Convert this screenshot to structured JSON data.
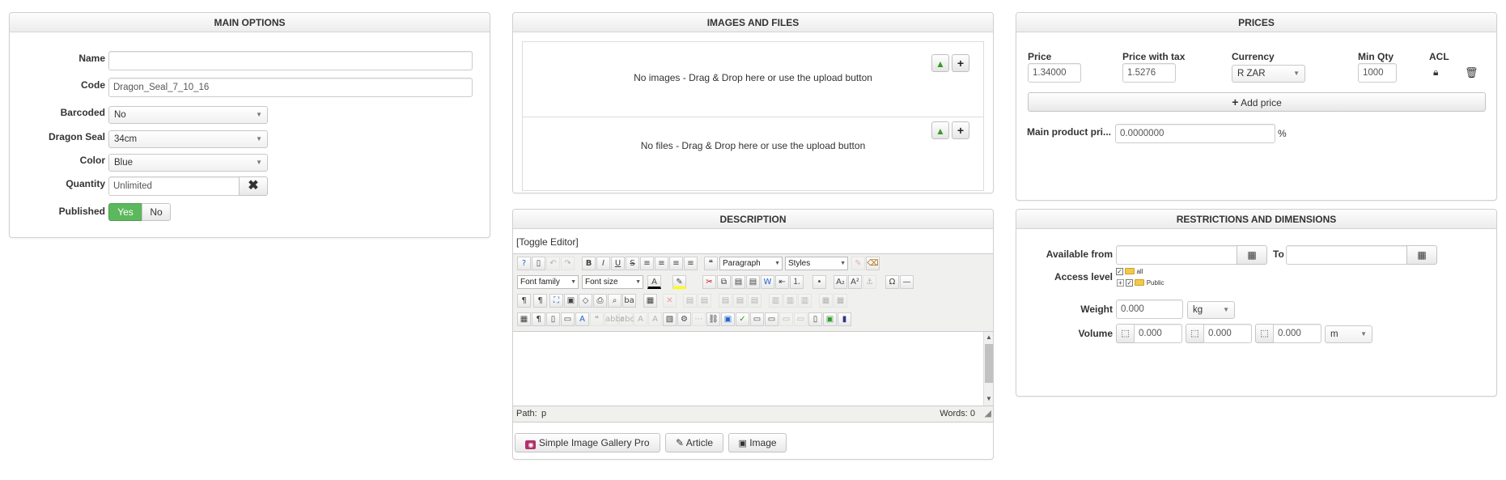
{
  "main_options": {
    "title": "MAIN OPTIONS",
    "name_label": "Name",
    "name_value": "",
    "code_label": "Code",
    "code_value": "Dragon_Seal_7_10_16",
    "barcoded_label": "Barcoded",
    "barcoded_value": "No",
    "dragon_seal_label": "Dragon Seal",
    "dragon_seal_value": "34cm",
    "color_label": "Color",
    "color_value": "Blue",
    "quantity_label": "Quantity",
    "quantity_value": "Unlimited",
    "published_label": "Published",
    "published_yes": "Yes",
    "published_no": "No"
  },
  "images_files": {
    "title": "IMAGES AND FILES",
    "no_images": "No images - Drag & Drop here or use the upload button",
    "no_files": "No files - Drag & Drop here or use the upload button"
  },
  "description": {
    "title": "DESCRIPTION",
    "toggle_editor": "[Toggle Editor]",
    "paragraph": "Paragraph",
    "styles": "Styles",
    "font_family": "Font family",
    "font_size": "Font size",
    "path_label": "Path:",
    "path_value": "p",
    "words_label": "Words: 0",
    "gallery_button": "Simple Image Gallery Pro",
    "article_button": "Article",
    "image_button": "Image"
  },
  "prices": {
    "title": "PRICES",
    "price_label": "Price",
    "price_tax_label": "Price with tax",
    "currency_label": "Currency",
    "min_qty_label": "Min Qty",
    "acl_label": "ACL",
    "price_value": "1.34000",
    "price_tax_value": "1.5276",
    "currency_value": "R ZAR",
    "min_qty_value": "1000",
    "add_price": "Add price",
    "main_product_label": "Main product pri...",
    "main_product_value": "0.0000000",
    "percent": "%"
  },
  "restrictions": {
    "title": "RESTRICTIONS AND DIMENSIONS",
    "available_from_label": "Available from",
    "to_label": "To",
    "access_level_label": "Access level",
    "access_all": "all",
    "access_public": "Public",
    "weight_label": "Weight",
    "weight_value": "0.000",
    "weight_unit": "kg",
    "volume_label": "Volume",
    "volume_1": "0.000",
    "volume_2": "0.000",
    "volume_3": "0.000",
    "volume_unit": "m"
  },
  "colors": {
    "published_yes_bg": "#5cb85c",
    "panel_border": "#d0d0d0",
    "upload_green": "#3a9a2a"
  }
}
